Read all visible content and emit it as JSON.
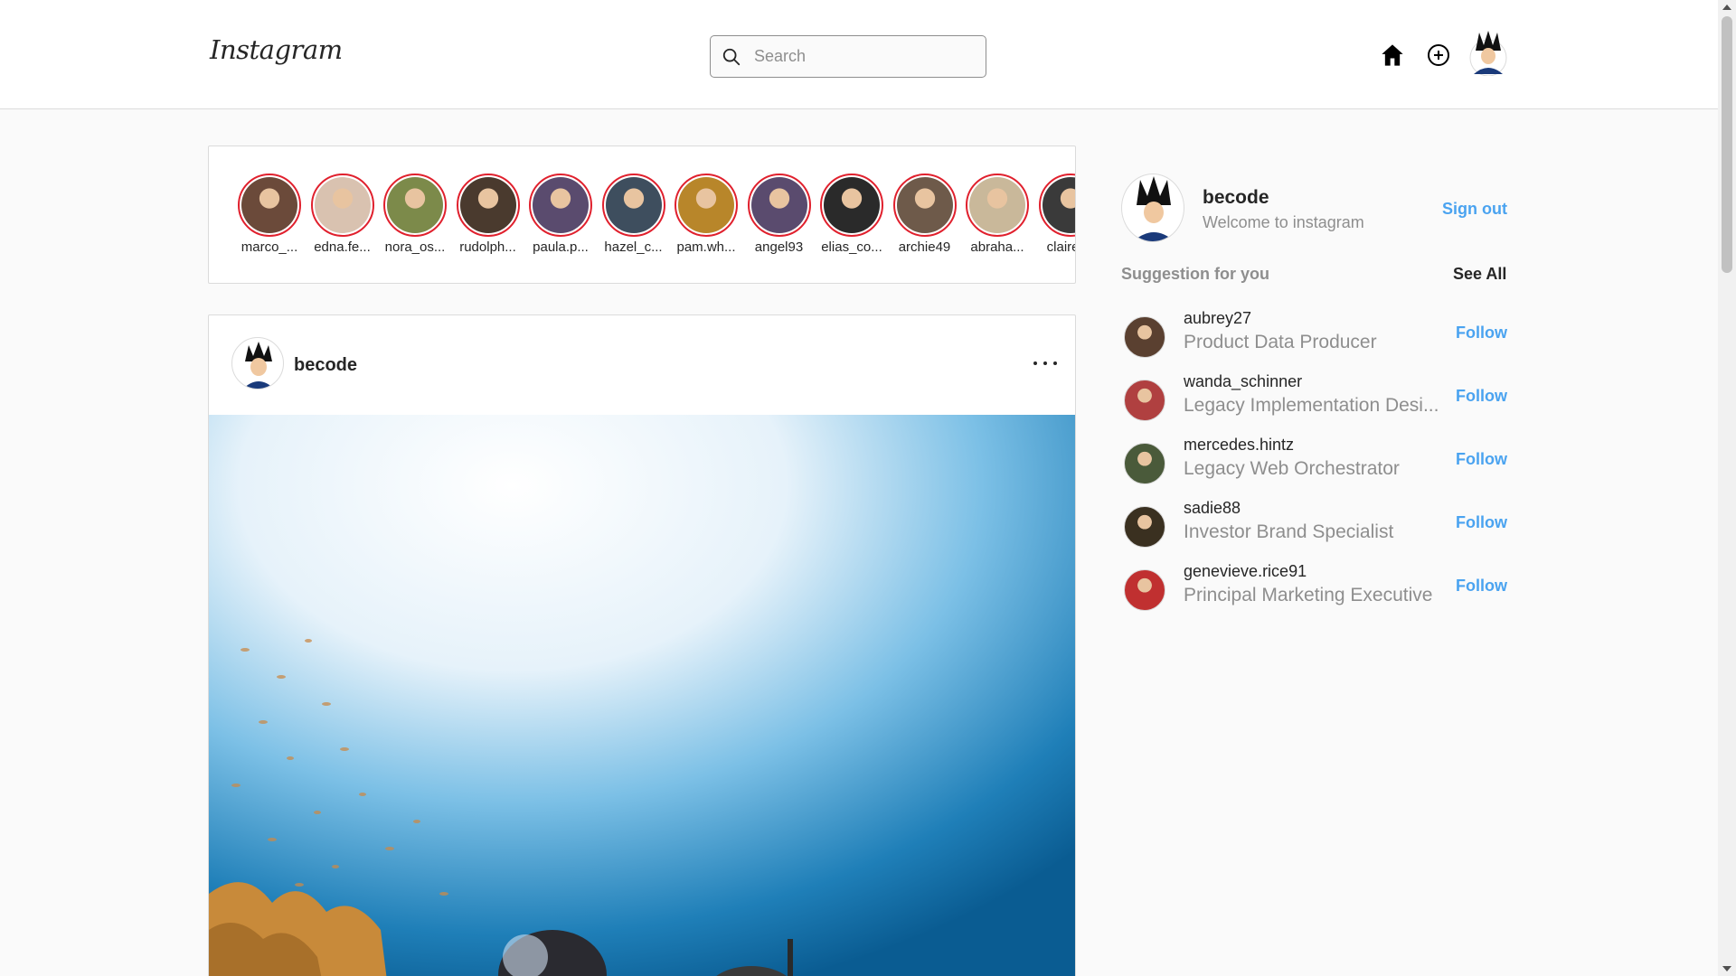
{
  "header": {
    "logo": "Instagram",
    "search_placeholder": "Search",
    "icons": [
      "home-icon",
      "add-post-icon",
      "profile-avatar"
    ]
  },
  "stories": [
    {
      "name": "marco_...",
      "color": "#6b4a3a"
    },
    {
      "name": "edna.fe...",
      "color": "#d9c2b0"
    },
    {
      "name": "nora_os...",
      "color": "#7c8a4a"
    },
    {
      "name": "rudolph...",
      "color": "#4a3a2e"
    },
    {
      "name": "paula.p...",
      "color": "#5a4b6e"
    },
    {
      "name": "hazel_c...",
      "color": "#3e4e5e"
    },
    {
      "name": "pam.wh...",
      "color": "#b8862a"
    },
    {
      "name": "angel93",
      "color": "#5a4b6e"
    },
    {
      "name": "elias_co...",
      "color": "#2a2a2a"
    },
    {
      "name": "archie49",
      "color": "#6e5a4a"
    },
    {
      "name": "abraha...",
      "color": "#c9b89a"
    },
    {
      "name": "claire_c",
      "color": "#3a3a3a"
    }
  ],
  "post": {
    "username": "becode",
    "more_icon": "more-options-icon"
  },
  "sidebar": {
    "username": "becode",
    "welcome": "Welcome to instagram",
    "sign_out": "Sign out",
    "suggestion_title": "Suggestion for you",
    "see_all": "See All",
    "follow_label": "Follow",
    "suggestions": [
      {
        "name": "aubrey27",
        "title": "Product Data Producer",
        "color": "#5a4030"
      },
      {
        "name": "wanda_schinner",
        "title": "Legacy Implementation Desi...",
        "color": "#b04040"
      },
      {
        "name": "mercedes.hintz",
        "title": "Legacy Web Orchestrator",
        "color": "#4a5a3a"
      },
      {
        "name": "sadie88",
        "title": "Investor Brand Specialist",
        "color": "#3a3020"
      },
      {
        "name": "genevieve.rice91",
        "title": "Principal Marketing Executive",
        "color": "#c03030"
      }
    ]
  },
  "colors": {
    "accent": "#4aa3f0",
    "story_ring": "#e0202d",
    "muted": "#8e8e8e",
    "text": "#262626"
  }
}
